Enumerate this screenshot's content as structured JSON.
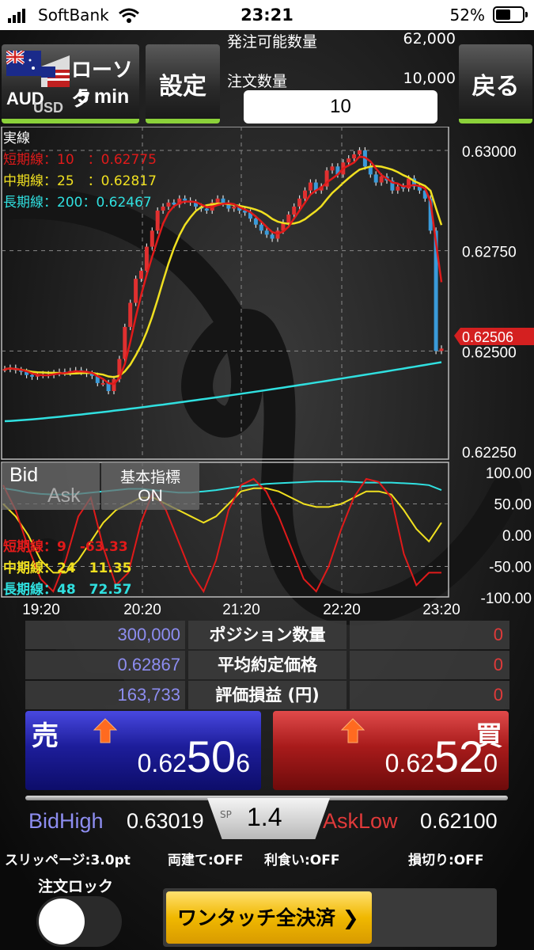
{
  "status_bar": {
    "carrier": "SoftBank",
    "time": "23:21",
    "battery": "52%"
  },
  "header": {
    "pair_base": "AUD",
    "pair_quote": "USD",
    "chart_type": "ローソク",
    "timeframe": "5 min",
    "settings_label": "設定",
    "back_label": "戻る",
    "available_qty_label": "発注可能数量",
    "available_qty_value": "62,000",
    "order_qty_label": "注文数量",
    "order_qty_value": "10,000",
    "order_qty_input": "10"
  },
  "chart": {
    "price_line_label": "実線",
    "short_line": "短期線：10　：0.62775",
    "mid_line": "中期線：25　：0.62817",
    "long_line": "長期線：200：0.62467",
    "price_ticks": [
      "0.63000",
      "0.62750",
      "0.62500",
      "0.62250"
    ],
    "current_price": "0.62506",
    "osc_ticks": [
      "100.00",
      "50.00",
      "0.00",
      "-50.00",
      "-100.00"
    ],
    "osc_short": "短期線：9　-63.33",
    "osc_mid": "中期線：24　11.35",
    "osc_long": "長期線：48　72.57",
    "time_ticks": [
      "19:20",
      "20:20",
      "21:20",
      "22:20",
      "23:20"
    ],
    "bid_label": "Bid",
    "ask_label": "Ask",
    "fundamental_label": "基本指標",
    "fundamental_state": "ON",
    "colors": {
      "up": "#e03030",
      "down": "#3a9ad9",
      "short": "#e01a1a",
      "mid": "#f0e020",
      "long": "#30e0e0"
    }
  },
  "chart_data": {
    "type": "line",
    "series": [
      {
        "name": "短期線：10",
        "latest": 0.62775
      },
      {
        "name": "中期線：25",
        "latest": 0.62817
      },
      {
        "name": "長期線：200",
        "latest": 0.62467
      }
    ],
    "x_ticks": [
      "19:20",
      "20:20",
      "21:20",
      "22:20",
      "23:20"
    ],
    "ylim": [
      0.6225,
      0.63
    ],
    "current": 0.62506
  },
  "positions": [
    {
      "value": "300,000",
      "label": "ポジション数量",
      "pl": "0"
    },
    {
      "value": "0.62867",
      "label": "平均約定価格",
      "pl": "0"
    },
    {
      "value": "163,733",
      "label": "評価損益 (円)",
      "pl": "0"
    }
  ],
  "sell": {
    "side": "売",
    "p1": "0.62",
    "p2": "50",
    "p3": "6"
  },
  "buy": {
    "side": "買",
    "p1": "0.62",
    "p2": "52",
    "p3": "0"
  },
  "spread": {
    "label": "SP",
    "value": "1.4"
  },
  "bid_high": {
    "label": "BidHigh",
    "value": "0.63019"
  },
  "ask_low": {
    "label": "AskLow",
    "value": "0.62100"
  },
  "options": {
    "slippage": "スリッページ:3.0pt",
    "hedge": "両建て:OFF",
    "take_profit": "利食い:OFF",
    "stop_loss": "損切り:OFF"
  },
  "order_lock_label": "注文ロック",
  "close_all_label": "ワンタッチ全決済"
}
